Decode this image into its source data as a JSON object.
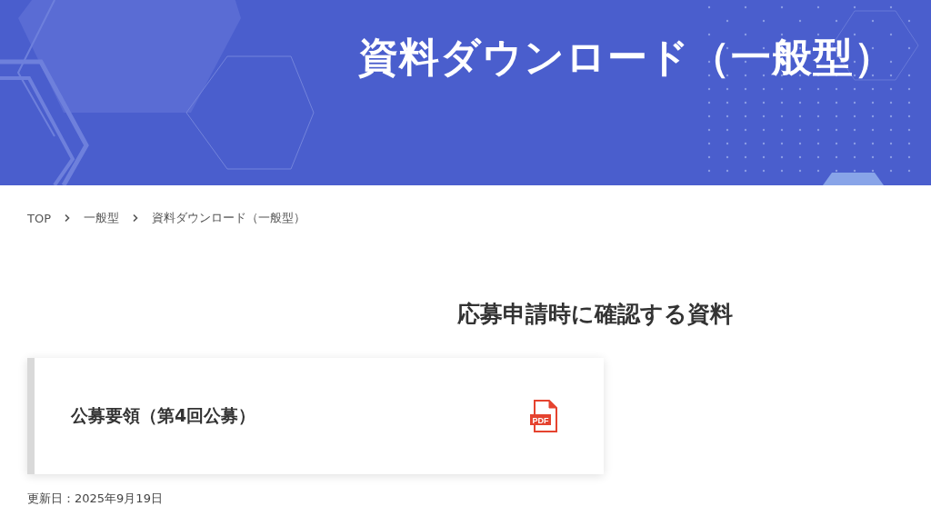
{
  "header": {
    "title": "資料ダウンロード（一般型）"
  },
  "breadcrumb": [
    {
      "label": "TOP"
    },
    {
      "label": "一般型"
    },
    {
      "label": "資料ダウンロード（一般型）"
    }
  ],
  "section": {
    "heading": "応募申請時に確認する資料"
  },
  "documents": [
    {
      "title": "公募要領（第4回公募）",
      "file_label": "PDF"
    }
  ],
  "updated": "更新日：2025年9月19日"
}
